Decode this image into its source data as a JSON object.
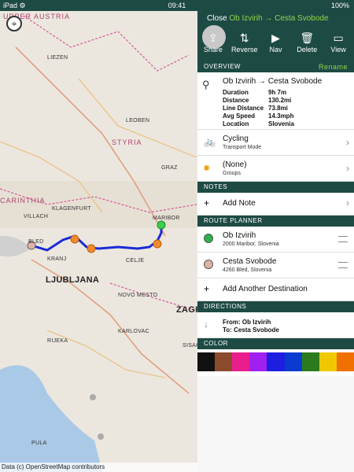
{
  "status": {
    "left": "iPad ⚙",
    "time": "09:41",
    "right": "100%"
  },
  "attribution": "Data (c) OpenStreetMap contributors",
  "map_labels": [
    "UPPER AUSTRIA",
    "STYRIA",
    "CARINTHIA",
    "LJUBLJANA",
    "ZAGREB",
    "LIEZEN",
    "LEOBEN",
    "GRAZ",
    "VILLACH",
    "KLAGENFURT",
    "MARIBOR",
    "CELJE",
    "KRANJ",
    "NOVO MESTO",
    "KARLOVAC",
    "RIJEKA",
    "PULA",
    "BLED",
    "SISAK"
  ],
  "header": {
    "close_label": "Close",
    "route_title": "Ob Izvirih → Cesta Svobode"
  },
  "toolbar": [
    {
      "label": "Share",
      "icon": "⇪"
    },
    {
      "label": "Reverse",
      "icon": "⇅"
    },
    {
      "label": "Nav",
      "icon": "▶"
    },
    {
      "label": "Delete",
      "icon": "🗑"
    },
    {
      "label": "View",
      "icon": "▭"
    }
  ],
  "overview": {
    "section": "OVERVIEW",
    "rename": "Rename",
    "title": "Ob Izvirih → Cesta Svobode",
    "stats": [
      {
        "key": "Duration",
        "value": "9h 7m"
      },
      {
        "key": "Distance",
        "value": "130.2mi"
      },
      {
        "key": "Line Distance",
        "value": "73.8mi"
      },
      {
        "key": "Avg Speed",
        "value": "14.3mph"
      },
      {
        "key": "Location",
        "value": "Slovenia"
      }
    ]
  },
  "transport": {
    "title": "Cycling",
    "subtitle": "Transport Mode"
  },
  "groups": {
    "title": "(None)",
    "subtitle": "Groups"
  },
  "notes": {
    "section": "NOTES",
    "add": "Add Note"
  },
  "planner": {
    "section": "ROUTE PLANNER",
    "stops": [
      {
        "title": "Ob Izvirih",
        "address": "2000 Maribor, Slovenia",
        "color": "#2db24a"
      },
      {
        "title": "Cesta Svobode",
        "address": "4260 Bled, Slovenia",
        "color": "#e0b4a4"
      }
    ],
    "add": "Add Another Destination"
  },
  "directions": {
    "section": "DIRECTIONS",
    "from": "From: Ob Izvirih",
    "to": "To: Cesta Svobode"
  },
  "color": {
    "section": "COLOR",
    "swatches": [
      "#111111",
      "#8b4a2b",
      "#e91e8c",
      "#a020f0",
      "#1e1ee0",
      "#0a3ad0",
      "#2c7a1c",
      "#f0c800",
      "#f07000"
    ]
  }
}
